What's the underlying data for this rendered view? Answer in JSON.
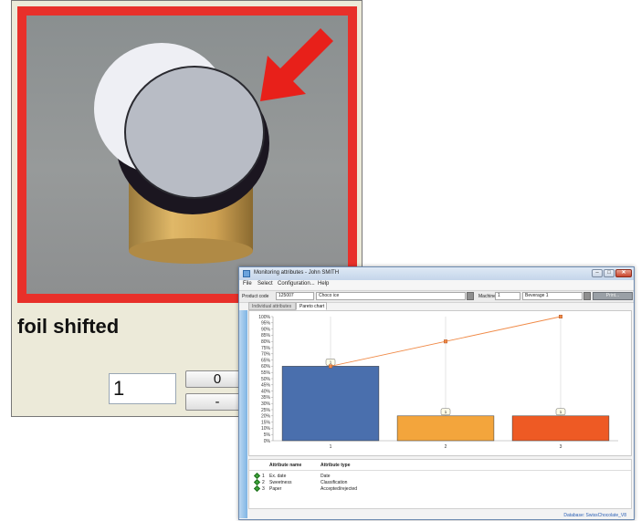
{
  "defect_window": {
    "label": "foil shifted",
    "count_value": "1",
    "zero_button": "0",
    "minus_button": "-"
  },
  "monitor_window": {
    "title": "Monitoring attributes - John SMITH",
    "menu": [
      "File",
      "Select",
      "Configuration...",
      "Help"
    ],
    "toolbar": {
      "product_code_label": "Product code",
      "product_code": "125007",
      "product_name": "Choco ice",
      "machine_label": "Machine",
      "machine_no": "1",
      "machine_name": "Beverage 1",
      "print_button": "Print..."
    },
    "tabs": [
      "Individual attributes",
      "Pareto chart"
    ],
    "table": {
      "headers": [
        "Attribute name",
        "Attribute type"
      ],
      "rows": [
        {
          "num": "1",
          "name": "Ex. date",
          "type": "Date"
        },
        {
          "num": "2",
          "name": "Sweetness",
          "type": "Classification"
        },
        {
          "num": "3",
          "name": "Paper",
          "type": "Accepted/rejected"
        }
      ]
    },
    "database": "Database: SwissChocolate_V8"
  },
  "chart_data": {
    "type": "bar",
    "categories": [
      "1",
      "2",
      "3"
    ],
    "values": [
      1,
      1,
      1
    ],
    "bar_heights_pct": [
      60,
      20,
      20
    ],
    "cumulative_pct": [
      60,
      80,
      100
    ],
    "bar_colors": [
      "#4a6fad",
      "#f3a53c",
      "#ee5a24"
    ],
    "line_color": "#f08a47",
    "yticks": [
      "0%",
      "5%",
      "10%",
      "15%",
      "20%",
      "25%",
      "30%",
      "35%",
      "40%",
      "45%",
      "50%",
      "55%",
      "60%",
      "65%",
      "70%",
      "75%",
      "80%",
      "85%",
      "90%",
      "95%",
      "100%"
    ],
    "ylim": [
      0,
      100
    ],
    "xlabel": "",
    "ylabel": "",
    "grid": false
  }
}
